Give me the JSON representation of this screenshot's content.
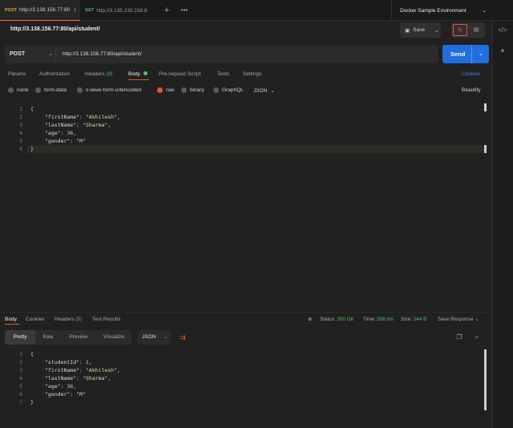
{
  "tabs": [
    {
      "method": "POST",
      "label": "http://3.138.156.77:80",
      "unsaved": true,
      "active": true
    },
    {
      "method": "GET",
      "label": "http://3.135.233.238:8",
      "unsaved": true,
      "active": false
    }
  ],
  "environment": "Docker Sample Environment",
  "request_title": "http://3.138.156.77:80/api/student/",
  "save_label": "Save",
  "request": {
    "method": "POST",
    "url": "http://3.138.156.77:80/api/student/",
    "send_label": "Send"
  },
  "request_tabs": {
    "params": "Params",
    "authorization": "Authorization",
    "headers": "Headers",
    "headers_count": "(9)",
    "body": "Body",
    "prerequest": "Pre-request Script",
    "tests": "Tests",
    "settings": "Settings",
    "cookies": "Cookies"
  },
  "body_modes": {
    "none": "none",
    "form_data": "form-data",
    "urlencoded": "x-www-form-urlencoded",
    "raw": "raw",
    "binary": "binary",
    "graphql": "GraphQL",
    "format": "JSON",
    "beautify": "Beautify"
  },
  "request_body": {
    "line_numbers": [
      "1",
      "2",
      "3",
      "4",
      "5",
      "6"
    ],
    "open": "{",
    "fields": [
      {
        "key": "\"firstName\"",
        "value": "\"Akhilesh\"",
        "sep": ": ",
        "tail": ","
      },
      {
        "key": "\"lastName\"",
        "value": "\"Sharma\"",
        "sep": ": ",
        "tail": ","
      },
      {
        "key": "\"age\"",
        "value": "36",
        "sep": ": ",
        "tail": ","
      },
      {
        "key": "\"gender\"",
        "value": "\"M\"",
        "sep": ": ",
        "tail": ""
      }
    ],
    "close": "}"
  },
  "response_tabs": {
    "body": "Body",
    "cookies": "Cookies",
    "headers": "Headers",
    "headers_count": "(5)",
    "test_results": "Test Results"
  },
  "response_meta": {
    "status_label": "Status:",
    "status": "200 OK",
    "time_label": "Time:",
    "time": "558 ms",
    "size_label": "Size:",
    "size": "244 B",
    "save_response": "Save Response"
  },
  "response_view": {
    "pretty": "Pretty",
    "raw": "Raw",
    "preview": "Preview",
    "visualize": "Visualize",
    "format": "JSON"
  },
  "response_body": {
    "line_numbers": [
      "1",
      "2",
      "3",
      "4",
      "5",
      "6",
      "7"
    ],
    "open": "{",
    "fields": [
      {
        "key": "\"studentId\"",
        "value": "1",
        "sep": ": ",
        "tail": ","
      },
      {
        "key": "\"firstName\"",
        "value": "\"Akhilesh\"",
        "sep": ": ",
        "tail": ","
      },
      {
        "key": "\"lastName\"",
        "value": "\"Sharma\"",
        "sep": ": ",
        "tail": ","
      },
      {
        "key": "\"age\"",
        "value": "36",
        "sep": ": ",
        "tail": ","
      },
      {
        "key": "\"gender\"",
        "value": "\"M\"",
        "sep": ": ",
        "tail": ""
      }
    ],
    "close": "}"
  },
  "icons": {
    "env_chevron": "chevron-down-icon",
    "rb_code": "code-icon",
    "rb_bulb": "bulb-icon"
  },
  "colors": {
    "accent": "#e8562f",
    "send": "#1f6fe0",
    "link": "#3d8ae8",
    "status_ok": "#4ec06a"
  }
}
